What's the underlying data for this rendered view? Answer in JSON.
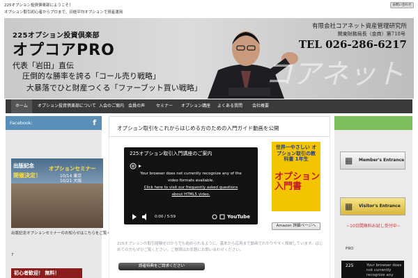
{
  "topbar": {
    "line1": "225オプション投資倶楽部にようこそ！",
    "line2": "オプション取引初心者からプロまで、日経平均オプションで資産運用",
    "contact": "お問い合わせ"
  },
  "header": {
    "club": "225オプション投資倶楽部",
    "brand": "オプコアPRO",
    "line1": "代表「岩田」直伝",
    "line2": "圧倒的な勝率を誇る「コール売り戦略」",
    "line3": "大暴落でひと財産つくる「ファーブット買い戦略」",
    "company": "有限会社コアネット資産管理研究所",
    "registration": "関東財務局長（金商）第718号",
    "tel": "TEL 026-286-6217",
    "deco": "コアネット"
  },
  "nav": {
    "items": [
      "ホーム",
      "オプション投資倶楽部について",
      "入会のご案内",
      "会員の声",
      "セミナー",
      "オプション講座",
      "よくある質問",
      "会社概要"
    ]
  },
  "left": {
    "bar_label": "Facebook:",
    "fb_icon": "f",
    "card": {
      "t1": "出版記念",
      "t2": "オプションセミナー",
      "t3": "開催決定！",
      "date1": "10/14 東京",
      "date2": "10/21 大阪"
    },
    "caption": "出版記念オプションセミナーのお知らせはこちらをご覧ください",
    "sub": "7",
    "banner": "初心者歓迎！ 無料！"
  },
  "main": {
    "title": "オプション取引をこれからはじめる方のための入門ガイド動画を公開",
    "video_title": "225オプション取引入門講座のご案内",
    "video_msg1": "Your browser does not currently recognize any of the",
    "video_msg2": "video formats available.",
    "video_link1": "Click here to visit our frequently asked questions",
    "video_link2": "about HTML5 video.",
    "time": "0:00 / 5:59",
    "youtube": "YouTube",
    "book_title": "世界一やさしい オプション取引の教科書 1年生",
    "book_label": "オプション 入門書",
    "amazon": "Amazon 詳細ページへ",
    "desc": "225オプションの取引経験ゼロからでも始められるように、基本から応用まで動画でわかりやすく解説しています。はじめての方もぜひご覧ください。ご質問はお気軽にお問い合わせください。",
    "signup": "読者特典をご請求ください"
  },
  "right": {
    "member": "Member's Entrance",
    "visitor": "Visitor's Entrance",
    "link": "~10日間無料お試し受付中~",
    "pro": "PRO",
    "video_title": "225",
    "video_msg": "Your browser does not currently recognize any"
  },
  "colors": {
    "nav_bg": "#3a3a3a",
    "facebook_bar": "#5a8fb8",
    "right_bar": "#7cbf5a"
  }
}
